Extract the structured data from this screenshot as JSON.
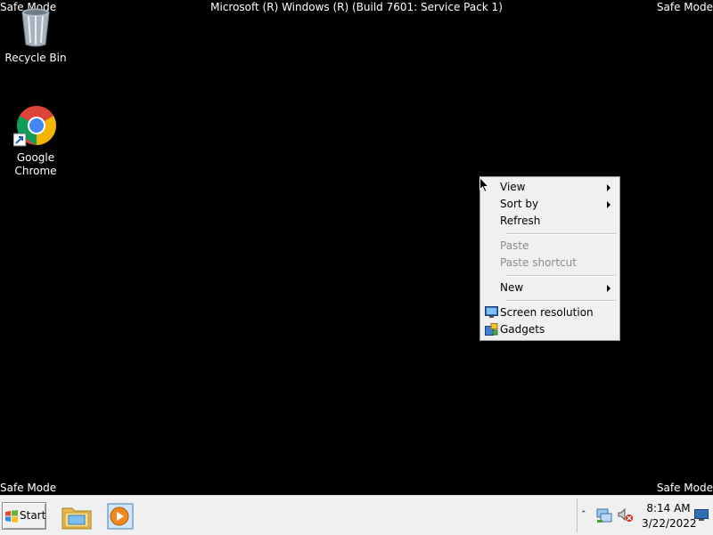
{
  "overlay": {
    "safe_mode_top_left": "Safe Mode",
    "safe_mode_top_right": "Safe Mode",
    "safe_mode_bottom_left": "Safe Mode",
    "safe_mode_bottom_right": "Safe Mode",
    "build_title": "Microsoft (R) Windows (R) (Build 7601: Service Pack 1)"
  },
  "desktop": {
    "icons": [
      {
        "label": "Recycle Bin",
        "icon": "recycle-bin-icon"
      },
      {
        "label": "Google Chrome",
        "icon": "chrome-icon",
        "line1": "Google",
        "line2": "Chrome"
      }
    ]
  },
  "context_menu": {
    "items": [
      {
        "label": "View",
        "submenu": true,
        "enabled": true
      },
      {
        "label": "Sort by",
        "submenu": true,
        "enabled": true
      },
      {
        "label": "Refresh",
        "submenu": false,
        "enabled": true
      },
      {
        "label": "Paste",
        "submenu": false,
        "enabled": false
      },
      {
        "label": "Paste shortcut",
        "submenu": false,
        "enabled": false
      },
      {
        "label": "New",
        "submenu": true,
        "enabled": true
      },
      {
        "label": "Screen resolution",
        "submenu": false,
        "enabled": true,
        "icon": "monitor-icon"
      },
      {
        "label": "Gadgets",
        "submenu": false,
        "enabled": true,
        "icon": "gadgets-icon"
      }
    ]
  },
  "taskbar": {
    "start_label": "Start",
    "pinned": [
      "windows-explorer-icon",
      "media-player-icon"
    ],
    "tray": {
      "clock_time": "8:14 AM",
      "clock_date": "3/22/2022"
    }
  }
}
